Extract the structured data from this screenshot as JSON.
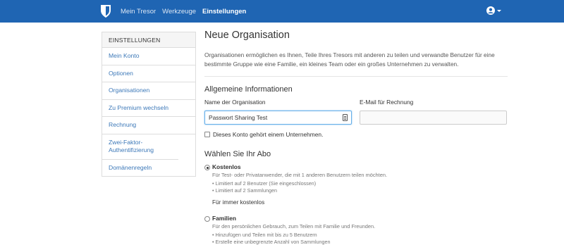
{
  "navbar": {
    "logo_icon": "shield-icon",
    "links": [
      "Mein Tresor",
      "Werkzeuge",
      "Einstellungen"
    ],
    "active_index": 2,
    "account_icon": "user-account-icon",
    "brand_color": "#1f65b3"
  },
  "sidebar": {
    "heading": "EINSTELLUNGEN",
    "items": [
      "Mein Konto",
      "Optionen",
      "Organisationen",
      "Zu Premium wechseln",
      "Rechnung",
      "Zwei-Faktor-Authentifizierung",
      "Domänenregeln"
    ]
  },
  "main": {
    "title": "Neue Organisation",
    "lead": "Organisationen ermöglichen es Ihnen, Teile Ihres Tresors mit anderen zu teilen und verwandte Benutzer für eine bestimmte Gruppe wie eine Familie, ein kleines Team oder ein großes Unternehmen zu verwalten.",
    "general_heading": "Allgemeine Informationen",
    "org_name_label": "Name der Organisation",
    "org_name_value": "Passwort Sharing Test",
    "billing_email_label": "E-Mail für Rechnung",
    "billing_email_value": "",
    "business_checkbox_label": "Dieses Konto gehört einem Unternehmen.",
    "business_checked": false,
    "plan_heading": "Wählen Sie Ihr Abo",
    "plans": [
      {
        "name": "Kostenlos",
        "selected": true,
        "description": "Für Test- oder Privatanwender, die mit 1 anderen Benutzern teilen möchten.",
        "features": [
          "• Limitiert auf 2 Benutzer (Sie eingeschlossen)",
          "• Limitiert auf 2 Sammlungen"
        ],
        "price": "Für immer kostenlos"
      },
      {
        "name": "Familien",
        "selected": false,
        "description": "Für den persönlichen Gebrauch, zum Teilen mit Familie und Freunden.",
        "features": [
          "• Hinzufügen und Teilen mit bis zu 5 Benutzern",
          "• Erstelle eine unbegrenzte Anzahl von Sammlungen"
        ]
      }
    ]
  }
}
